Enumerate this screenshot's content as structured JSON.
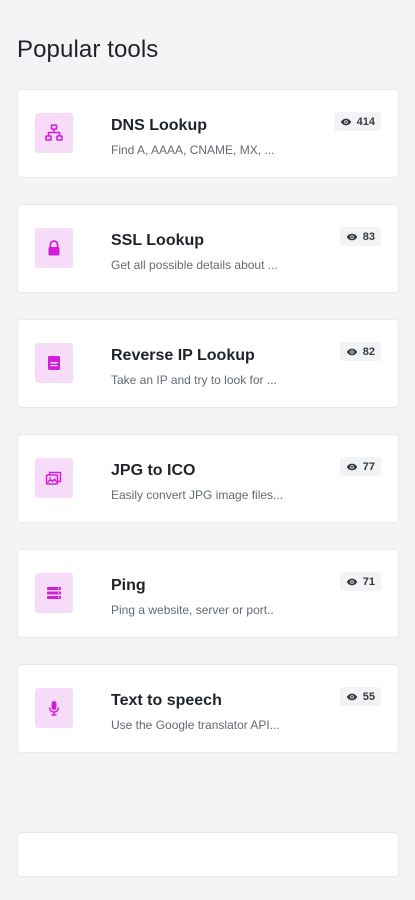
{
  "section": {
    "title": "Popular tools"
  },
  "colors": {
    "accent": "#d11fd9",
    "icon_bg": "#f7dcf9",
    "page_bg": "#f3f4f6"
  },
  "tools": [
    {
      "name": "DNS Lookup",
      "description": "Find A, AAAA, CNAME, MX, ...",
      "views": "414",
      "icon": "sitemap-icon"
    },
    {
      "name": "SSL Lookup",
      "description": "Get all possible details about ...",
      "views": "83",
      "icon": "lock-icon"
    },
    {
      "name": "Reverse IP Lookup",
      "description": "Take an IP and try to look for ...",
      "views": "82",
      "icon": "server-icon"
    },
    {
      "name": "JPG to ICO",
      "description": "Easily convert JPG image files...",
      "views": "77",
      "icon": "images-icon"
    },
    {
      "name": "Ping",
      "description": "Ping a website, server or port..",
      "views": "71",
      "icon": "list-server-icon"
    },
    {
      "name": "Text to speech",
      "description": "Use the Google translator API...",
      "views": "55",
      "icon": "microphone-icon"
    }
  ]
}
